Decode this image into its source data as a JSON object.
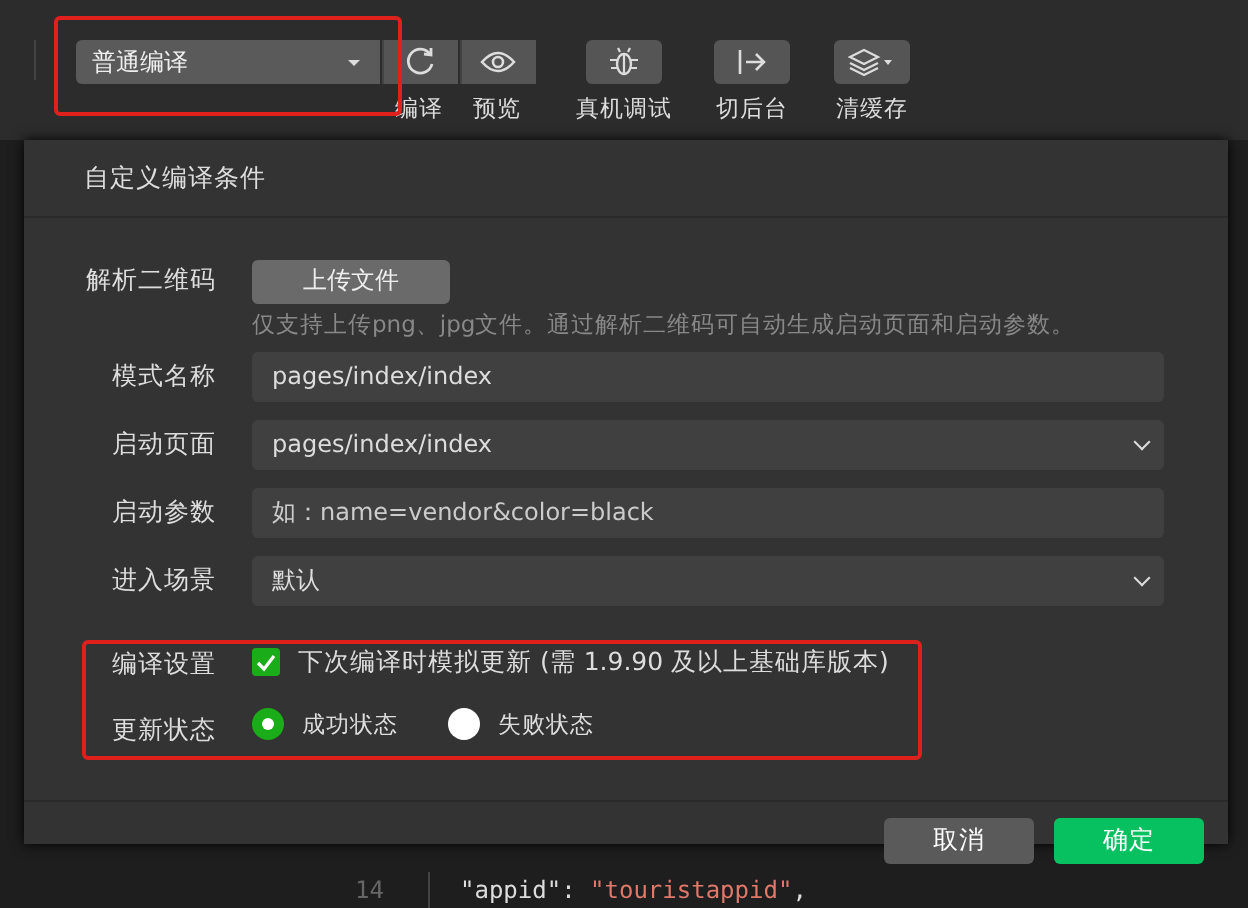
{
  "toolbar": {
    "compile_mode": {
      "value": "普通编译"
    },
    "buttons": [
      {
        "kind": "refresh",
        "label": "编译"
      },
      {
        "kind": "preview",
        "label": "预览"
      },
      {
        "kind": "debug",
        "label": "真机调试"
      },
      {
        "kind": "background",
        "label": "切后台"
      },
      {
        "kind": "cache",
        "label": "清缓存"
      }
    ]
  },
  "dialog": {
    "title": "自定义编译条件",
    "fields": [
      {
        "kind": "upload",
        "label": "解析二维码",
        "button": "上传文件",
        "hint": "仅支持上传png、jpg文件。通过解析二维码可自动生成启动页面和启动参数。"
      },
      {
        "kind": "text",
        "label": "模式名称",
        "value": "pages/index/index"
      },
      {
        "kind": "select",
        "label": "启动页面",
        "value": "pages/index/index"
      },
      {
        "kind": "text",
        "label": "启动参数",
        "placeholder": "如：name=vendor&color=black"
      },
      {
        "kind": "select",
        "label": "进入场景",
        "value": "默认"
      },
      {
        "kind": "checkbox",
        "label": "编译设置",
        "text": "下次编译时模拟更新 (需 1.9.90 及以上基础库版本)",
        "checked": true
      },
      {
        "kind": "radio",
        "label": "更新状态",
        "options": [
          {
            "label": "成功状态",
            "selected": true
          },
          {
            "label": "失败状态",
            "selected": false
          }
        ]
      }
    ],
    "buttons": [
      {
        "kind": "cancel",
        "label": "取消"
      },
      {
        "kind": "confirm",
        "label": "确定"
      }
    ]
  },
  "code": {
    "line_number": "14",
    "tokens": [
      {
        "kind": "string",
        "text": "\"appid\""
      },
      {
        "kind": "punct",
        "text": ": "
      },
      {
        "kind": "value",
        "text": "\"touristappid\""
      },
      {
        "kind": "punct",
        "text": ","
      }
    ]
  }
}
